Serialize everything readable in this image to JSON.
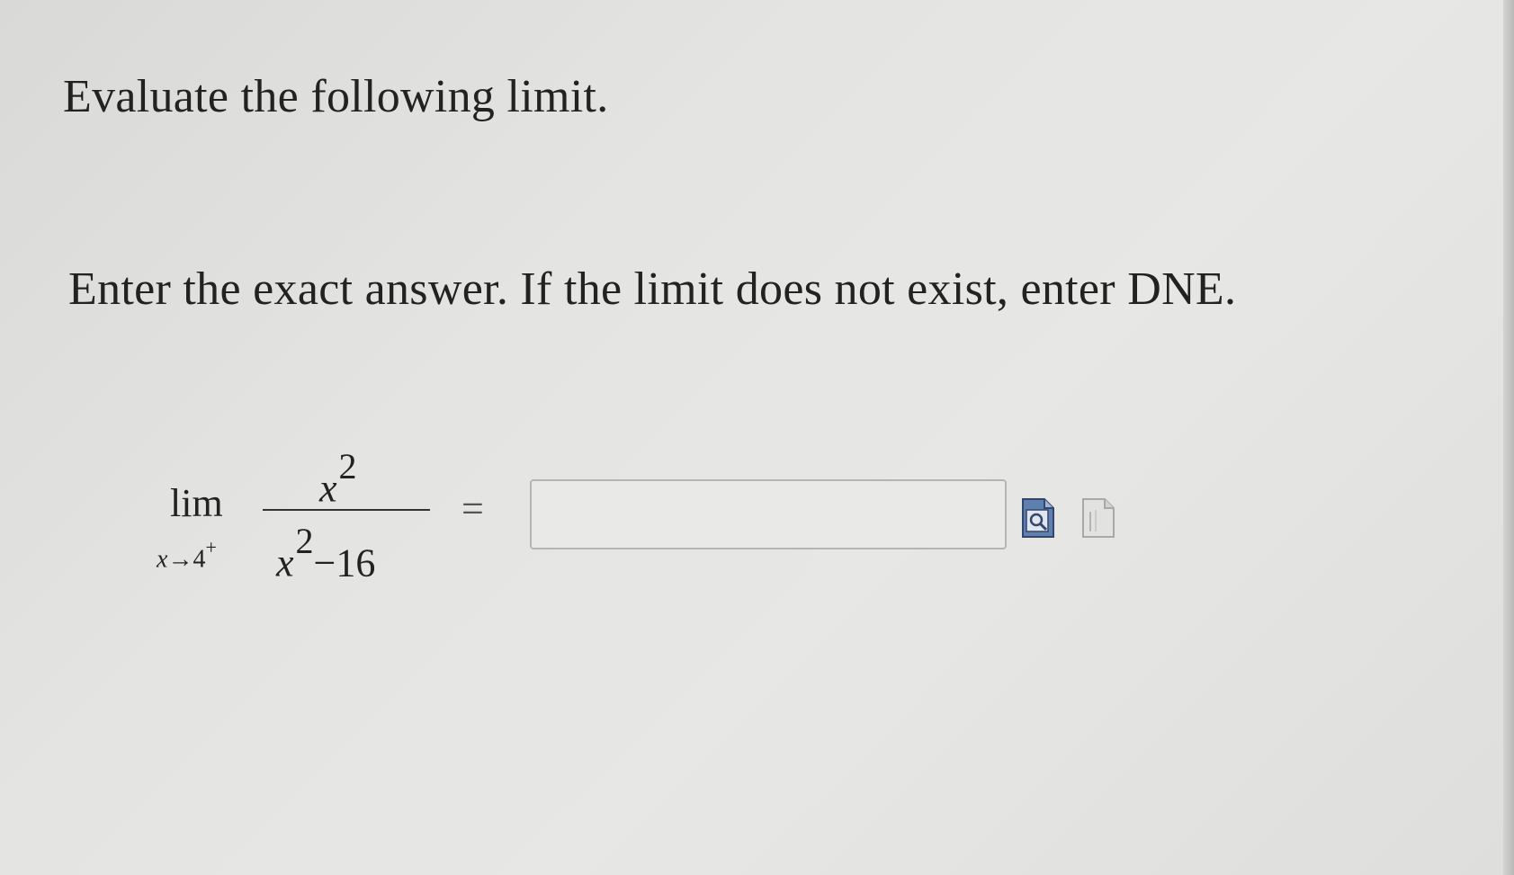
{
  "question": {
    "title": "Evaluate the following limit.",
    "instructions": "Enter the exact answer. If the limit does not exist, enter DNE."
  },
  "expression": {
    "lim": "lim",
    "variable": "x",
    "arrow": "→",
    "approach_value": "4",
    "approach_side": "+",
    "numerator_base": "x",
    "numerator_exponent": "2",
    "denominator_base": "x",
    "denominator_exponent": "2",
    "denominator_rest": "−16",
    "equals": "="
  },
  "answer": {
    "value": "",
    "placeholder": ""
  },
  "icons": {
    "preview": "preview-search-icon",
    "help": "help-document-icon"
  }
}
